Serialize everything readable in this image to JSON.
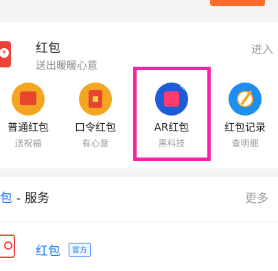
{
  "hongbao": {
    "title": "红包",
    "subtitle": "送出暖暖心意",
    "enter_label": "进入",
    "icon_symbol": "¥"
  },
  "types": [
    {
      "label": "普通红包",
      "sub": "送祝福",
      "icon": "normal-hongbao-icon"
    },
    {
      "label": "口令红包",
      "sub": "有心意",
      "icon": "password-hongbao-icon"
    },
    {
      "label": "AR红包",
      "sub": "黑科技",
      "icon": "ar-hongbao-icon",
      "badge": "AR"
    },
    {
      "label": "红包记录",
      "sub": "查明细",
      "icon": "record-icon"
    }
  ],
  "services": {
    "title_prefix": "包",
    "title_rest": " - 服务",
    "more_label": "更多",
    "item_label": "红包",
    "item_tag": "官方"
  },
  "colors": {
    "highlight": "#ff20a8",
    "accent_blue": "#1677ff",
    "hongbao_red": "#f1403c"
  }
}
